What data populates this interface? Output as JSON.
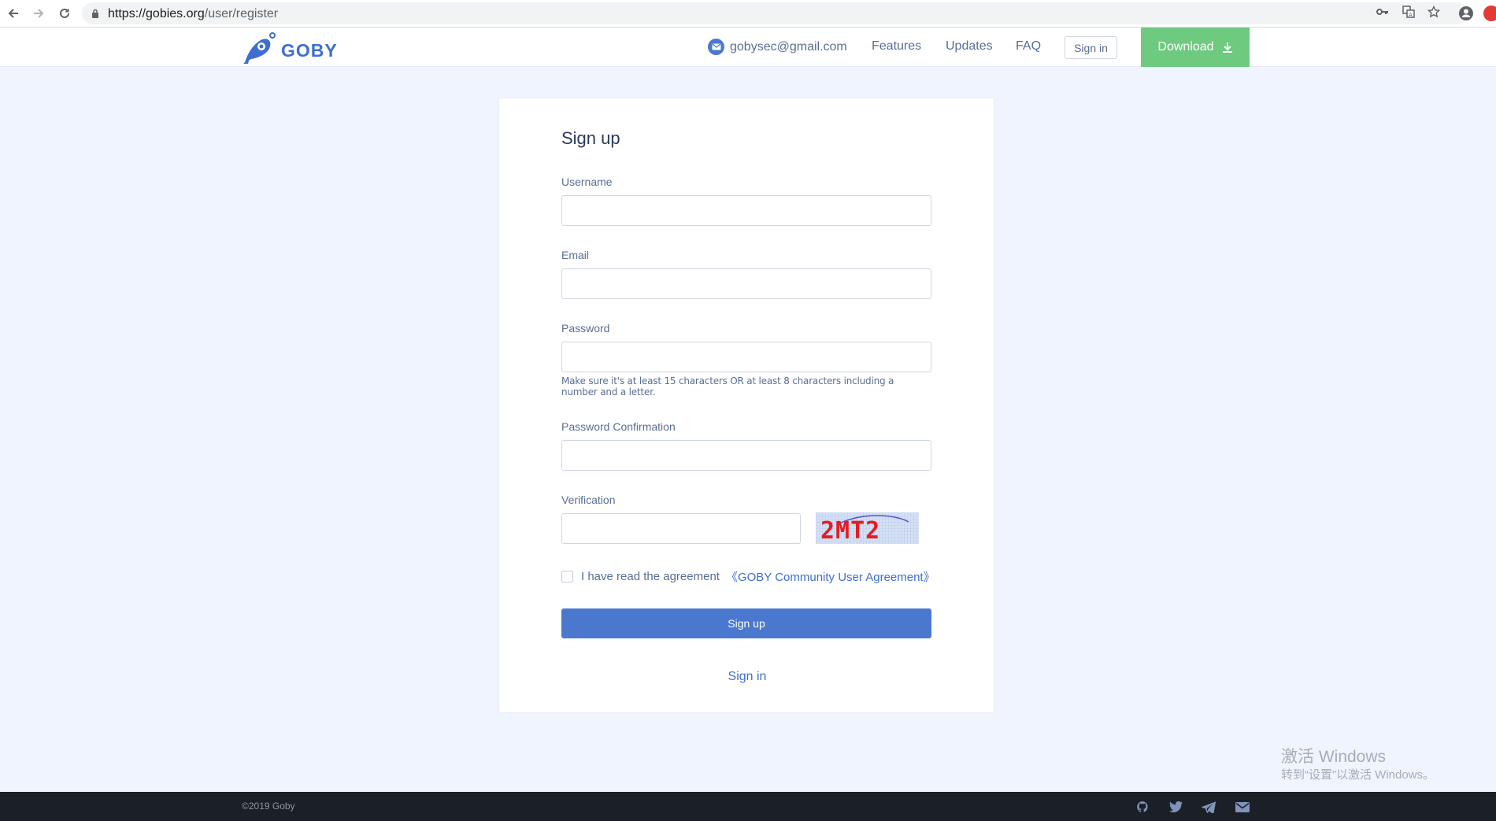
{
  "browser": {
    "url_host": "https://gobies.org",
    "url_path": "/user/register"
  },
  "header": {
    "logo_text": "GOBY",
    "contact_email": "gobysec@gmail.com",
    "nav": [
      "Features",
      "Updates",
      "FAQ"
    ],
    "signin_label": "Sign in",
    "download_label": "Download"
  },
  "form": {
    "title": "Sign up",
    "fields": [
      {
        "label": "Username",
        "value": "",
        "placeholder": ""
      },
      {
        "label": "Email",
        "value": "",
        "placeholder": ""
      },
      {
        "label": "Password",
        "value": "",
        "placeholder": ""
      },
      {
        "label": "Password Confirmation",
        "value": "",
        "placeholder": ""
      },
      {
        "label": "Verification",
        "value": "",
        "placeholder": ""
      }
    ],
    "password_hint": "Make sure it's at least 15 characters OR at least 8 characters including a number and a letter.",
    "captcha_text": "2MT2",
    "agreement_text": "I have read the agreement",
    "agreement_link": "《GOBY Community User Agreement》",
    "agreement_checked": false,
    "submit_label": "Sign up",
    "signin_link": "Sign in"
  },
  "watermark": {
    "title": "激活 Windows",
    "subtitle": "转到“设置”以激活 Windows。"
  },
  "footer": {
    "copyright": "©2019 Goby",
    "social_icons": [
      "github-icon",
      "twitter-icon",
      "telegram-icon",
      "mail-icon"
    ]
  },
  "colors": {
    "accent": "#4a78cf",
    "download_green": "#6dca7f",
    "page_bg": "#eff4fe",
    "footer_bg": "#1b1f26",
    "text_muted": "#5a6e94"
  }
}
